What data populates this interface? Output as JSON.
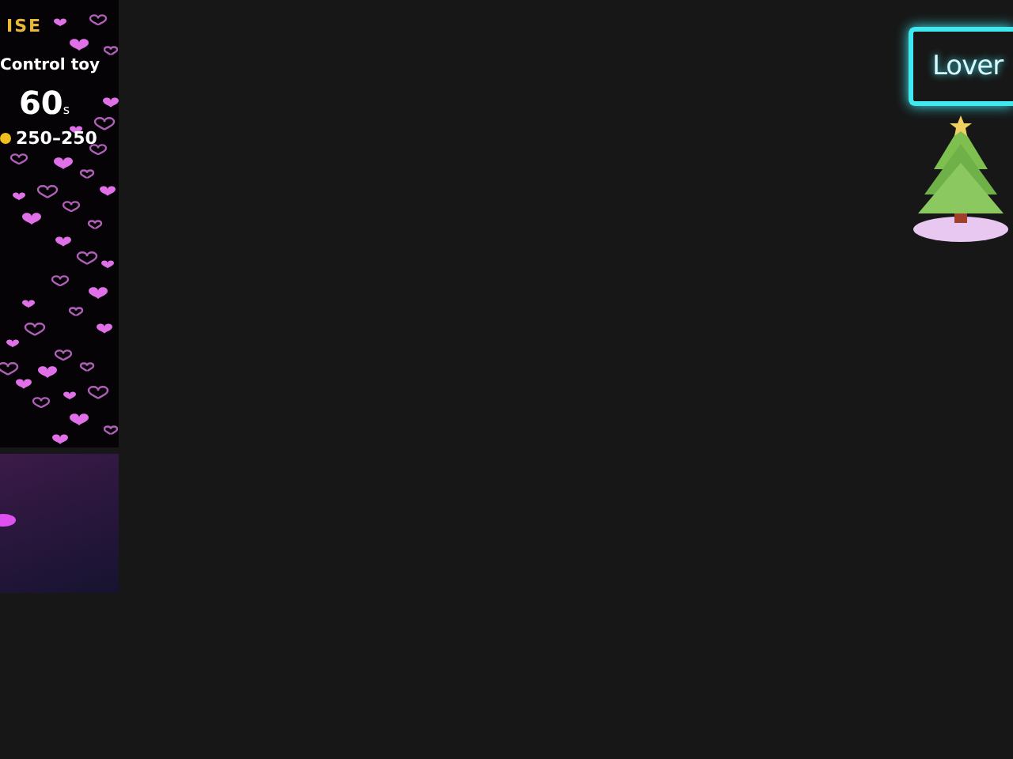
{
  "logo": {
    "text": "ISE"
  },
  "toy_panel": {
    "title": "Control toy",
    "duration": "60",
    "unit": "s",
    "range": "250–250"
  },
  "neon_sign": {
    "text": "Lover"
  }
}
